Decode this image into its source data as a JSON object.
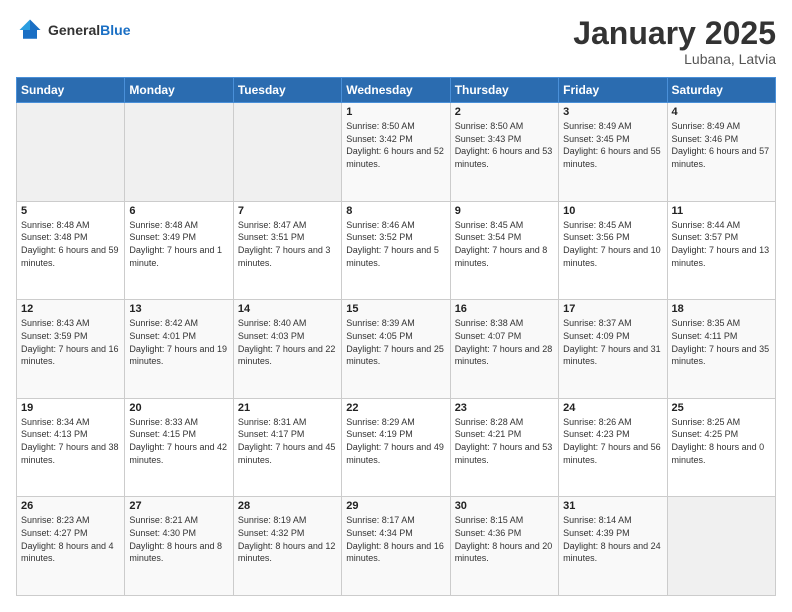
{
  "header": {
    "logo_general": "General",
    "logo_blue": "Blue",
    "month_title": "January 2025",
    "location": "Lubana, Latvia"
  },
  "days_of_week": [
    "Sunday",
    "Monday",
    "Tuesday",
    "Wednesday",
    "Thursday",
    "Friday",
    "Saturday"
  ],
  "weeks": [
    [
      {
        "day": "",
        "info": ""
      },
      {
        "day": "",
        "info": ""
      },
      {
        "day": "",
        "info": ""
      },
      {
        "day": "1",
        "info": "Sunrise: 8:50 AM\nSunset: 3:42 PM\nDaylight: 6 hours\nand 52 minutes."
      },
      {
        "day": "2",
        "info": "Sunrise: 8:50 AM\nSunset: 3:43 PM\nDaylight: 6 hours\nand 53 minutes."
      },
      {
        "day": "3",
        "info": "Sunrise: 8:49 AM\nSunset: 3:45 PM\nDaylight: 6 hours\nand 55 minutes."
      },
      {
        "day": "4",
        "info": "Sunrise: 8:49 AM\nSunset: 3:46 PM\nDaylight: 6 hours\nand 57 minutes."
      }
    ],
    [
      {
        "day": "5",
        "info": "Sunrise: 8:48 AM\nSunset: 3:48 PM\nDaylight: 6 hours\nand 59 minutes."
      },
      {
        "day": "6",
        "info": "Sunrise: 8:48 AM\nSunset: 3:49 PM\nDaylight: 7 hours\nand 1 minute."
      },
      {
        "day": "7",
        "info": "Sunrise: 8:47 AM\nSunset: 3:51 PM\nDaylight: 7 hours\nand 3 minutes."
      },
      {
        "day": "8",
        "info": "Sunrise: 8:46 AM\nSunset: 3:52 PM\nDaylight: 7 hours\nand 5 minutes."
      },
      {
        "day": "9",
        "info": "Sunrise: 8:45 AM\nSunset: 3:54 PM\nDaylight: 7 hours\nand 8 minutes."
      },
      {
        "day": "10",
        "info": "Sunrise: 8:45 AM\nSunset: 3:56 PM\nDaylight: 7 hours\nand 10 minutes."
      },
      {
        "day": "11",
        "info": "Sunrise: 8:44 AM\nSunset: 3:57 PM\nDaylight: 7 hours\nand 13 minutes."
      }
    ],
    [
      {
        "day": "12",
        "info": "Sunrise: 8:43 AM\nSunset: 3:59 PM\nDaylight: 7 hours\nand 16 minutes."
      },
      {
        "day": "13",
        "info": "Sunrise: 8:42 AM\nSunset: 4:01 PM\nDaylight: 7 hours\nand 19 minutes."
      },
      {
        "day": "14",
        "info": "Sunrise: 8:40 AM\nSunset: 4:03 PM\nDaylight: 7 hours\nand 22 minutes."
      },
      {
        "day": "15",
        "info": "Sunrise: 8:39 AM\nSunset: 4:05 PM\nDaylight: 7 hours\nand 25 minutes."
      },
      {
        "day": "16",
        "info": "Sunrise: 8:38 AM\nSunset: 4:07 PM\nDaylight: 7 hours\nand 28 minutes."
      },
      {
        "day": "17",
        "info": "Sunrise: 8:37 AM\nSunset: 4:09 PM\nDaylight: 7 hours\nand 31 minutes."
      },
      {
        "day": "18",
        "info": "Sunrise: 8:35 AM\nSunset: 4:11 PM\nDaylight: 7 hours\nand 35 minutes."
      }
    ],
    [
      {
        "day": "19",
        "info": "Sunrise: 8:34 AM\nSunset: 4:13 PM\nDaylight: 7 hours\nand 38 minutes."
      },
      {
        "day": "20",
        "info": "Sunrise: 8:33 AM\nSunset: 4:15 PM\nDaylight: 7 hours\nand 42 minutes."
      },
      {
        "day": "21",
        "info": "Sunrise: 8:31 AM\nSunset: 4:17 PM\nDaylight: 7 hours\nand 45 minutes."
      },
      {
        "day": "22",
        "info": "Sunrise: 8:29 AM\nSunset: 4:19 PM\nDaylight: 7 hours\nand 49 minutes."
      },
      {
        "day": "23",
        "info": "Sunrise: 8:28 AM\nSunset: 4:21 PM\nDaylight: 7 hours\nand 53 minutes."
      },
      {
        "day": "24",
        "info": "Sunrise: 8:26 AM\nSunset: 4:23 PM\nDaylight: 7 hours\nand 56 minutes."
      },
      {
        "day": "25",
        "info": "Sunrise: 8:25 AM\nSunset: 4:25 PM\nDaylight: 8 hours\nand 0 minutes."
      }
    ],
    [
      {
        "day": "26",
        "info": "Sunrise: 8:23 AM\nSunset: 4:27 PM\nDaylight: 8 hours\nand 4 minutes."
      },
      {
        "day": "27",
        "info": "Sunrise: 8:21 AM\nSunset: 4:30 PM\nDaylight: 8 hours\nand 8 minutes."
      },
      {
        "day": "28",
        "info": "Sunrise: 8:19 AM\nSunset: 4:32 PM\nDaylight: 8 hours\nand 12 minutes."
      },
      {
        "day": "29",
        "info": "Sunrise: 8:17 AM\nSunset: 4:34 PM\nDaylight: 8 hours\nand 16 minutes."
      },
      {
        "day": "30",
        "info": "Sunrise: 8:15 AM\nSunset: 4:36 PM\nDaylight: 8 hours\nand 20 minutes."
      },
      {
        "day": "31",
        "info": "Sunrise: 8:14 AM\nSunset: 4:39 PM\nDaylight: 8 hours\nand 24 minutes."
      },
      {
        "day": "",
        "info": ""
      }
    ]
  ]
}
